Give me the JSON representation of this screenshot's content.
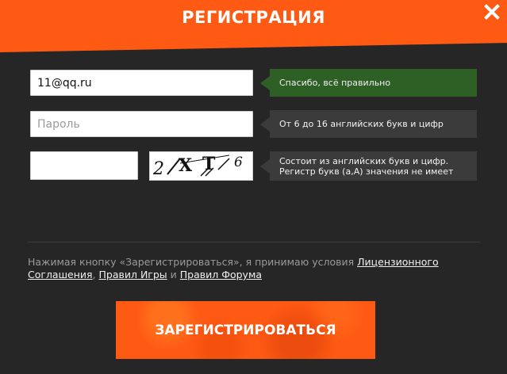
{
  "header": {
    "title": "РЕГИСТРАЦИЯ",
    "close_icon": "close-icon",
    "bg_color": "#ff5a14"
  },
  "form": {
    "email": {
      "value": "11@qq.ru",
      "hint": "Спасибо, всё правильно",
      "hint_status": "ok",
      "hint_color": "#2e5f24"
    },
    "password": {
      "value": "",
      "placeholder": "Пароль",
      "hint": "От 6 до 16 английских букв и цифр"
    },
    "captcha": {
      "value": "",
      "image_text": "2XT6",
      "hint_line1": "Состоит из английских букв и цифр.",
      "hint_line2": "Регистр букв (a,A) значения не имеет"
    }
  },
  "terms": {
    "prefix": "Нажимая кнопку «Зарегистрироваться», я принимаю условия ",
    "link_license": "Лицензионного Соглашения",
    "sep1": ", ",
    "link_rules": "Правил Игры",
    "sep2": " и ",
    "link_forum": "Правил Форума"
  },
  "submit": {
    "label": "ЗАРЕГИСТРИРОВАТЬСЯ",
    "color": "#ff5a14"
  }
}
